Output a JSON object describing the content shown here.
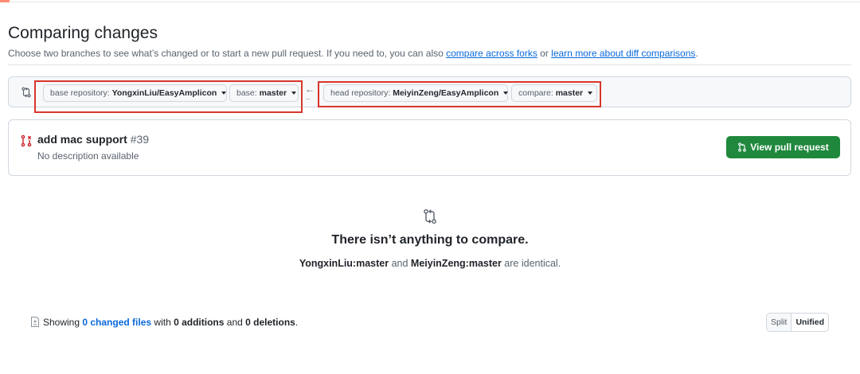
{
  "header": {
    "title": "Comparing changes",
    "subtitle_prefix": "Choose two branches to see what’s changed or to start a new pull request. If you need to, you can also ",
    "link_forks": "compare across forks",
    "subtitle_or": " or ",
    "link_learn": "learn more about diff comparisons",
    "subtitle_end": "."
  },
  "range": {
    "base_repo_label": "base repository: ",
    "base_repo_value": "YongxinLiu/EasyAmplicon",
    "base_label": "base: ",
    "base_value": "master",
    "head_repo_label": "head repository: ",
    "head_repo_value": "MeiyinZeng/EasyAmplicon",
    "compare_label": "compare: ",
    "compare_value": "master",
    "arrow": "←",
    "dots": "..."
  },
  "pull_request": {
    "title": "add mac support",
    "number": "#39",
    "description": "No description available",
    "button_label": "View pull request"
  },
  "blankslate": {
    "title": "There isn’t anything to compare.",
    "ref_a": "YongxinLiu:master",
    "and": " and ",
    "ref_b": "MeiyinZeng:master",
    "suffix": " are identical."
  },
  "summary": {
    "prefix": "Showing ",
    "files_link": "0 changed files",
    "with": " with ",
    "additions": "0 additions",
    "and": " and ",
    "deletions": "0 deletions",
    "end": "."
  },
  "view_toggle": {
    "split": "Split",
    "unified": "Unified"
  },
  "colors": {
    "accent_link": "#0969da",
    "primary_button": "#1f883d",
    "highlight_box": "#d9352b",
    "pr_closed_icon": "#cf222e"
  },
  "icons": {
    "range": "git-compare-icon",
    "pr": "git-pull-request-closed-icon",
    "button": "git-pull-request-icon",
    "blank": "git-compare-icon",
    "file": "file-diff-icon"
  }
}
